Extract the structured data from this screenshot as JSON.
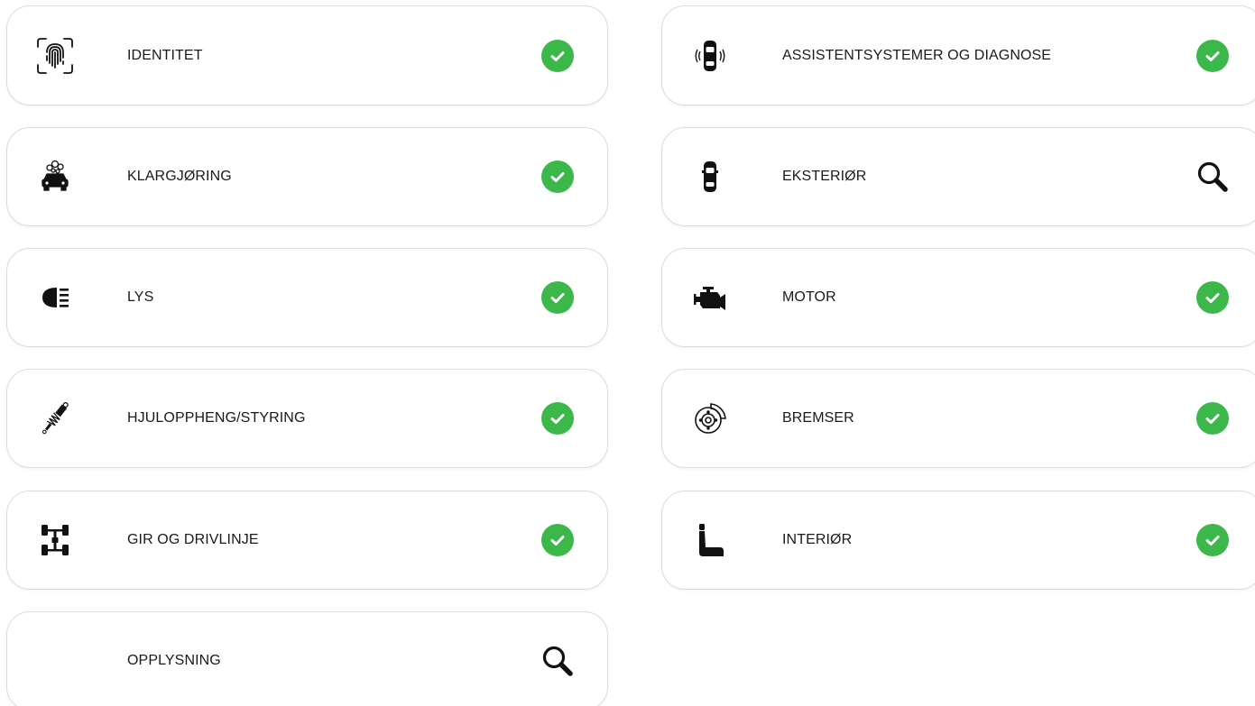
{
  "colors": {
    "check": "#3cb74a",
    "border": "#dcdcd6",
    "text": "#1a1a1a",
    "icon": "#111111"
  },
  "left": [
    {
      "label": "IDENTITET",
      "icon": "fingerprint-icon",
      "status": "check"
    },
    {
      "label": "KLARGJØRING",
      "icon": "car-wash-icon",
      "status": "check"
    },
    {
      "label": "LYS",
      "icon": "headlight-icon",
      "status": "check"
    },
    {
      "label": "HJULOPPHENG/STYRING",
      "icon": "shock-absorber-icon",
      "status": "check"
    },
    {
      "label": "GIR OG DRIVLINJE",
      "icon": "drivetrain-icon",
      "status": "check"
    },
    {
      "label": "OPPLYSNING",
      "icon": "",
      "status": "search"
    }
  ],
  "right": [
    {
      "label": "ASSISTENTSYSTEMER OG DIAGNOSE",
      "icon": "car-sensor-icon",
      "status": "check"
    },
    {
      "label": "EKSTERIØR",
      "icon": "car-top-icon",
      "status": "search"
    },
    {
      "label": "MOTOR",
      "icon": "engine-icon",
      "status": "check"
    },
    {
      "label": "BREMSER",
      "icon": "brake-disc-icon",
      "status": "check"
    },
    {
      "label": "INTERIØR",
      "icon": "car-seat-icon",
      "status": "check"
    }
  ]
}
